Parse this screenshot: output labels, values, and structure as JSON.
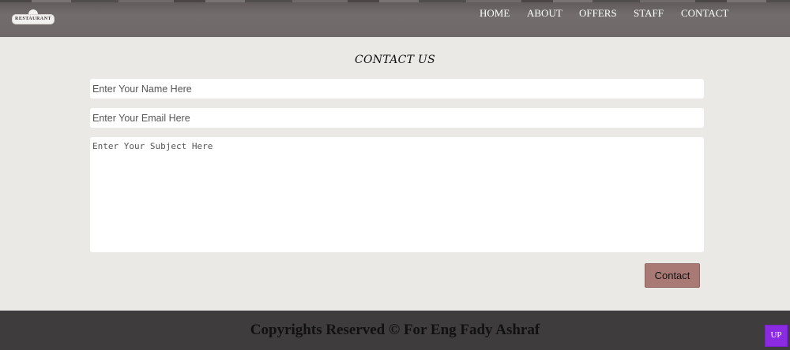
{
  "header": {
    "logo_text": "RESTAURANT",
    "nav": [
      {
        "label": "HOME"
      },
      {
        "label": "ABOUT"
      },
      {
        "label": "OFFERS"
      },
      {
        "label": "STAFF"
      },
      {
        "label": "CONTACT"
      }
    ]
  },
  "contact": {
    "title": "CONTACT US",
    "name_placeholder": "Enter Your Name Here",
    "email_placeholder": "Enter Your Email Here",
    "subject_placeholder": "Enter Your Subject Here",
    "button_label": "Contact"
  },
  "footer": {
    "copyright": "Copyrights Reserved © For Eng Fady Ashraf",
    "up_label": "UP"
  },
  "colors": {
    "accent_button": "#a97a75",
    "up_button": "#8a2be2",
    "footer_bg": "#3e3c3c",
    "page_bg": "#eae9e6"
  }
}
